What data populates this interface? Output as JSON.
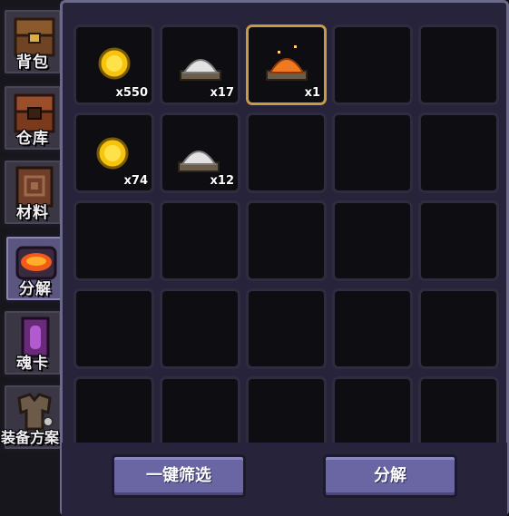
{
  "tabs": [
    {
      "label": "背包",
      "icon": "chest-icon",
      "active": false
    },
    {
      "label": "仓库",
      "icon": "warehouse-chest-icon",
      "active": false
    },
    {
      "label": "材料",
      "icon": "material-book-icon",
      "active": false
    },
    {
      "label": "分解",
      "icon": "furnace-icon",
      "active": true
    },
    {
      "label": "魂卡",
      "icon": "soul-card-icon",
      "active": false
    },
    {
      "label": "装备方案",
      "icon": "armor-icon",
      "active": false
    }
  ],
  "items": [
    {
      "icon": "gold-coin-icon",
      "qty": "x550"
    },
    {
      "icon": "white-powder-icon",
      "qty": "x17"
    },
    {
      "icon": "orange-powder-icon",
      "qty": "x1",
      "selected": true
    },
    {
      "icon": "gold-coin-icon",
      "qty": "x74"
    },
    {
      "icon": "white-powder-icon",
      "qty": "x12"
    }
  ],
  "buttons": {
    "filter_label": "一键筛选",
    "decompose_label": "分解"
  },
  "colors": {
    "panel_bg": "#26233a",
    "slot_bg": "#0e0d12",
    "selected_border": "#c99a45",
    "button_bg": "#6a66a3"
  }
}
